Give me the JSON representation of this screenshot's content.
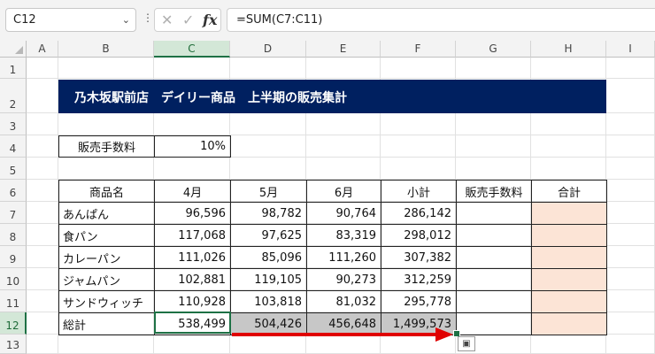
{
  "formula_bar": {
    "name_box": "C12",
    "cancel_glyph": "✕",
    "enter_glyph": "✓",
    "fx_label": "fx",
    "formula": "=SUM(C7:C11)"
  },
  "columns": [
    "A",
    "B",
    "C",
    "D",
    "E",
    "F",
    "G",
    "H",
    "I"
  ],
  "rows": [
    "1",
    "2",
    "3",
    "4",
    "5",
    "6",
    "7",
    "8",
    "9",
    "10",
    "11",
    "12",
    "13"
  ],
  "selected_column": "C",
  "selected_row": "12",
  "title": "乃木坂駅前店　デイリー商品　上半期の販売集計",
  "fee": {
    "label": "販売手数料",
    "value": "10%"
  },
  "table": {
    "headers": [
      "商品名",
      "4月",
      "5月",
      "6月",
      "小計",
      "販売手数料",
      "合計"
    ],
    "rows": [
      [
        "あんぱん",
        "96,596",
        "98,782",
        "90,764",
        "286,142",
        "",
        ""
      ],
      [
        "食パン",
        "117,068",
        "97,625",
        "83,319",
        "298,012",
        "",
        ""
      ],
      [
        "カレーパン",
        "111,026",
        "85,096",
        "111,260",
        "307,382",
        "",
        ""
      ],
      [
        "ジャムパン",
        "102,881",
        "119,105",
        "90,273",
        "312,259",
        "",
        ""
      ],
      [
        "サンドウィッチ",
        "110,928",
        "103,818",
        "81,032",
        "295,778",
        "",
        ""
      ]
    ],
    "total": [
      "総計",
      "538,499",
      "504,426",
      "456,648",
      "1,499,573",
      "",
      ""
    ]
  },
  "colors": {
    "title_bg": "#002060",
    "selection": "#1e7145",
    "total_column_fill": "#fce4d6",
    "highlight_fill": "#c7c7c7",
    "arrow": "#e00000"
  },
  "icons": {
    "autofill_options": "paste-options-icon",
    "arrow": "red-arrow-annotation"
  }
}
